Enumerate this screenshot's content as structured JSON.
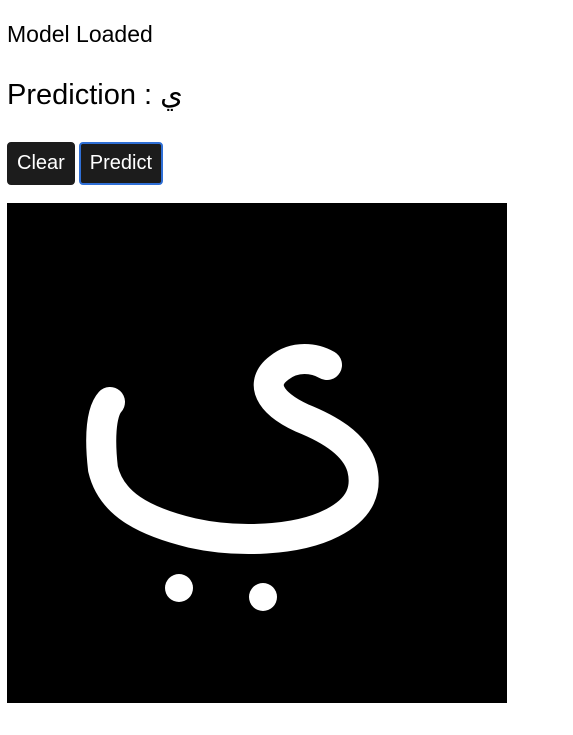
{
  "status": {
    "text": "Model Loaded"
  },
  "prediction": {
    "label": "Prediction : ",
    "value": "ي"
  },
  "toolbar": {
    "clear_label": "Clear",
    "predict_label": "Predict"
  },
  "canvas": {
    "background": "#000000",
    "stroke_color": "#ffffff"
  },
  "colors": {
    "button_bg": "#1c1c1c",
    "button_text": "#ffffff",
    "focus_ring": "#2f6fd6"
  }
}
